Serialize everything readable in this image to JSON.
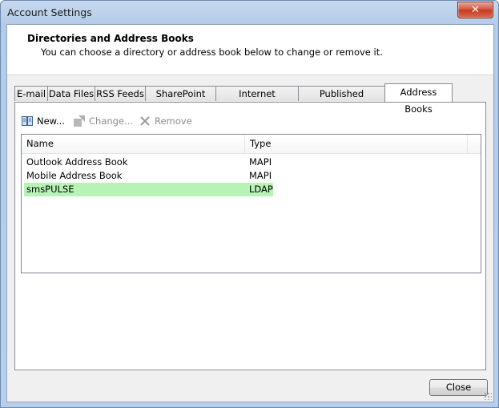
{
  "window": {
    "title": "Account Settings",
    "close_glyph": "✕"
  },
  "header": {
    "title": "Directories and Address Books",
    "subtitle": "You can choose a directory or address book below to change or remove it."
  },
  "tabs": [
    {
      "label": "E-mail",
      "active": false
    },
    {
      "label": "Data Files",
      "active": false
    },
    {
      "label": "RSS Feeds",
      "active": false
    },
    {
      "label": "SharePoint Lists",
      "active": false
    },
    {
      "label": "Internet Calendars",
      "active": false
    },
    {
      "label": "Published Calendars",
      "active": false
    },
    {
      "label": "Address Books",
      "active": true
    }
  ],
  "toolbar": {
    "new_label": "New...",
    "change_label": "Change...",
    "remove_label": "Remove",
    "new_icon": "address-book-icon",
    "change_icon": "change-icon",
    "remove_icon": "remove-x-icon"
  },
  "list": {
    "columns": [
      "Name",
      "Type"
    ],
    "rows": [
      {
        "name": "Outlook Address Book",
        "type": "MAPI",
        "selected": false
      },
      {
        "name": "Mobile Address Book",
        "type": "MAPI",
        "selected": false
      },
      {
        "name": "smsPULSE",
        "type": "LDAP",
        "selected": true
      }
    ]
  },
  "footer": {
    "close_label": "Close"
  },
  "colors": {
    "selected_row": "#b7f3b7",
    "title_close": "#c43a22"
  }
}
